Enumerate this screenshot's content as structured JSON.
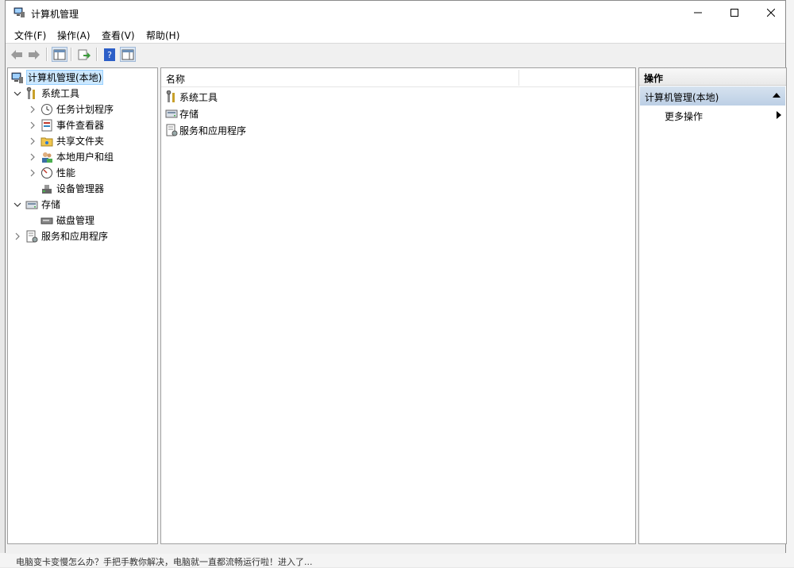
{
  "window": {
    "title": "计算机管理"
  },
  "menu": [
    "文件(F)",
    "操作(A)",
    "查看(V)",
    "帮助(H)"
  ],
  "tree": {
    "root": "计算机管理(本地)",
    "system_tools": "系统工具",
    "task_scheduler": "任务计划程序",
    "event_viewer": "事件查看器",
    "shared_folders": "共享文件夹",
    "local_users": "本地用户和组",
    "performance": "性能",
    "device_manager": "设备管理器",
    "storage": "存储",
    "disk_management": "磁盘管理",
    "services_apps": "服务和应用程序"
  },
  "list": {
    "column_name": "名称",
    "items": [
      "系统工具",
      "存储",
      "服务和应用程序"
    ]
  },
  "actions": {
    "header": "操作",
    "group": "计算机管理(本地)",
    "more": "更多操作"
  },
  "background": {
    "bottom_text": "电脑变卡变慢怎么办？手把手教你解决，电脑就一直都流畅运行啦！进入了..."
  },
  "colors": {
    "selection": "#cce8ff",
    "action_group": "#bccfe5"
  }
}
